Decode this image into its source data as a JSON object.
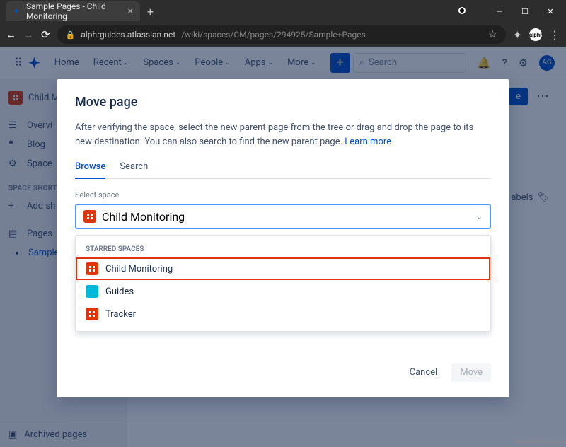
{
  "browser": {
    "tab_title": "Sample Pages - Child Monitoring",
    "url_host": "alphrguides.atlassian.net",
    "url_path": "/wiki/spaces/CM/pages/294925/Sample+Pages",
    "win": {
      "min": "—",
      "max": "☐",
      "close": "✕"
    }
  },
  "header": {
    "nav": {
      "home": "Home",
      "recent": "Recent",
      "spaces": "Spaces",
      "people": "People",
      "apps": "Apps",
      "more": "More"
    },
    "search_placeholder": "Search",
    "avatar": "AG"
  },
  "sidebar": {
    "space_name": "Child M",
    "items": {
      "overview": "Overvi",
      "blog": "Blog",
      "space": "Space"
    },
    "shortcuts_heading": "SPACE SHORTCU",
    "add": "Add sh",
    "pages": "Pages",
    "sample": "Sample",
    "archived": "Archived pages"
  },
  "content": {
    "share": "e",
    "labels": "abels"
  },
  "modal": {
    "title": "Move page",
    "desc": "After verifying the space, select the new parent page from the tree or drag and drop the page to its new destination. You can also search to find the new parent page. ",
    "learn_more": "Learn more",
    "tabs": {
      "browse": "Browse",
      "search": "Search"
    },
    "select_label": "Select space",
    "selected_space": "Child Monitoring",
    "dropdown": {
      "heading": "STARRED SPACES",
      "items": [
        "Child Monitoring",
        "Guides",
        "Tracker"
      ]
    },
    "buttons": {
      "cancel": "Cancel",
      "move": "Move"
    }
  },
  "watermark": "www.deuaq.com"
}
